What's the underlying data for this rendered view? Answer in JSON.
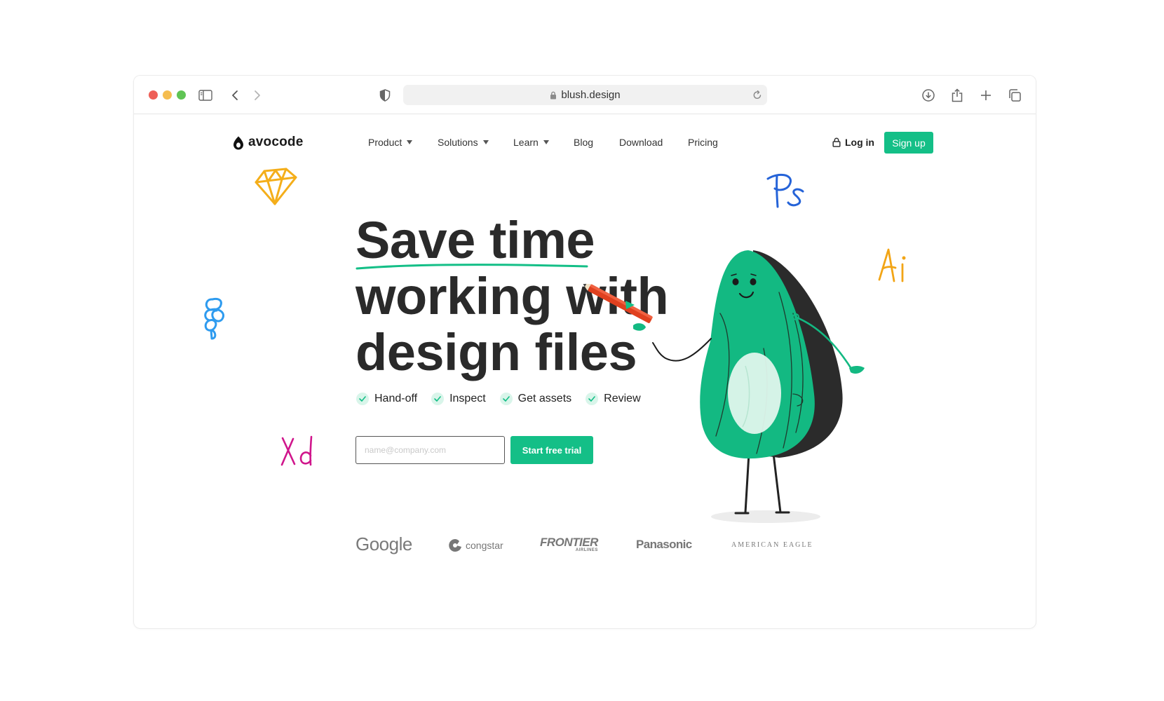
{
  "browser": {
    "url": "blush.design",
    "buttons": {
      "sidebar": "sidebar-icon",
      "back": "chevron-left-icon",
      "forward": "chevron-right-icon",
      "privacy": "shield-icon",
      "download": "download-icon",
      "share": "share-icon",
      "new_tab": "plus-icon",
      "tabs": "tabs-icon"
    }
  },
  "header": {
    "logo_text": "avocode",
    "nav": [
      {
        "label": "Product",
        "dropdown": true
      },
      {
        "label": "Solutions",
        "dropdown": true
      },
      {
        "label": "Learn",
        "dropdown": true
      },
      {
        "label": "Blog",
        "dropdown": false
      },
      {
        "label": "Download",
        "dropdown": false
      },
      {
        "label": "Pricing",
        "dropdown": false
      }
    ],
    "login_label": "Log in",
    "signup_label": "Sign up"
  },
  "hero": {
    "headline": [
      "Save time",
      "working with",
      "design files"
    ],
    "features": [
      "Hand-off",
      "Inspect",
      "Get assets",
      "Review"
    ],
    "email_placeholder": "name@company.com",
    "cta_label": "Start free trial"
  },
  "decorations": {
    "ps": "Ps",
    "ai": "Ai",
    "xd": "Xd"
  },
  "clients": {
    "google": "Google",
    "congstar": "congstar",
    "frontier": "FRONTIER",
    "frontier_sub": "AIRLINES",
    "panasonic": "Panasonic",
    "american_eagle": "AMERICAN EAGLE"
  },
  "colors": {
    "accent": "#14bf87",
    "avocado": "#13b982",
    "avocado_dark": "#2b2b2b",
    "sketch": "#f4ae1a",
    "ps": "#2563d8",
    "ai": "#f2a516",
    "xd": "#d0168c",
    "figma": "#2e9bef"
  }
}
